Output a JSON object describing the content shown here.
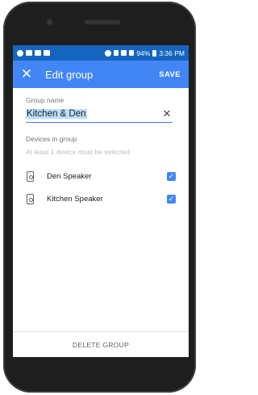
{
  "status_bar": {
    "battery": "94%",
    "time": "3:36 PM"
  },
  "appbar": {
    "title": "Edit group",
    "save_label": "SAVE",
    "close_icon": "close-icon"
  },
  "group_name": {
    "label": "Group name",
    "value": "Kitchen & Den"
  },
  "devices": {
    "section_label": "Devices in group",
    "hint": "At least 1 device must be selected",
    "items": [
      {
        "name": "Den Speaker",
        "checked": true,
        "icon": "speaker-icon"
      },
      {
        "name": "Kitchen Speaker",
        "checked": true,
        "icon": "speaker-icon"
      }
    ]
  },
  "footer": {
    "delete_label": "DELETE GROUP"
  },
  "colors": {
    "status_bar": "#1565c0",
    "app_bar": "#4285f4",
    "accent": "#4285f4"
  }
}
